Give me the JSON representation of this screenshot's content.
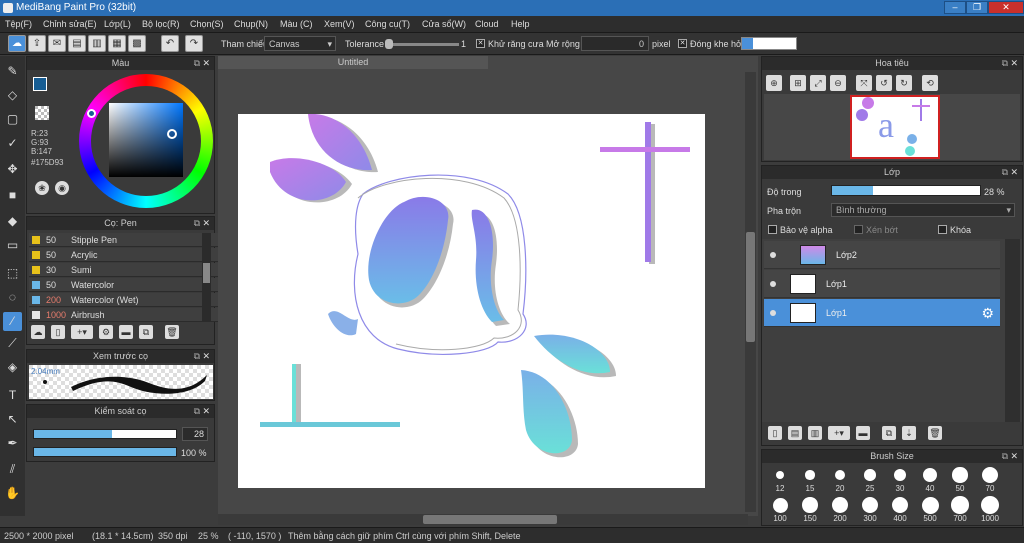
{
  "window": {
    "title": "MediBang Paint Pro (32bit)"
  },
  "menu": [
    "Tệp(F)",
    "Chỉnh sửa(E)",
    "Lớp(L)",
    "Bộ lọc(R)",
    "Chọn(S)",
    "Chụp(N)",
    "Màu (C)",
    "Xem(V)",
    "Công cụ(T)",
    "Cửa sổ(W)",
    "Cloud",
    "Help"
  ],
  "toolbar": {
    "reference_label": "Tham chiếu",
    "reference_value": "Canvas",
    "tolerance_label": "Tolerance",
    "tolerance_value": "1",
    "antialias_label": "Khử răng cưa",
    "expand_label": "Mở rộng",
    "expand_value": "0",
    "expand_unit": "pixel",
    "gap_close_label": "Đóng khe hở"
  },
  "color_panel": {
    "title": "Màu",
    "r": "R:23",
    "g": "G:93",
    "b": "B:147",
    "hex": "#175D93",
    "primary_color": "#175D93"
  },
  "brush_panel": {
    "title": "Cọ: Pen",
    "brushes": [
      {
        "size": "50",
        "name": "Stipple Pen",
        "color": "#e8c21a"
      },
      {
        "size": "50",
        "name": "Acrylic",
        "color": "#e8c21a"
      },
      {
        "size": "30",
        "name": "Sumi",
        "color": "#e8c21a"
      },
      {
        "size": "50",
        "name": "Watercolor",
        "color": "#6ab7e8"
      },
      {
        "size": "200",
        "name": "Watercolor (Wet)",
        "color": "#6ab7e8"
      },
      {
        "size": "1000",
        "name": "Airbrush",
        "color": "#e8e8e8"
      }
    ]
  },
  "brush_preview": {
    "title": "Xem trước cọ",
    "size": "2.04mm"
  },
  "brush_control": {
    "title": "Kiểm soát cọ",
    "size_value": "28",
    "opacity_value": "100 %",
    "size_fraction": 0.55,
    "opacity_fraction": 1.0
  },
  "canvas": {
    "tab": "Untitled"
  },
  "navigator": {
    "title": "Hoa tiêu"
  },
  "layer_panel": {
    "title": "Lớp",
    "opacity_label": "Độ trong",
    "opacity_value": "28 %",
    "opacity_fraction": 0.28,
    "blend_label": "Pha trộn",
    "blend_value": "Bình thường",
    "protect_alpha": "Bảo vệ alpha",
    "clipping": "Xén bớt",
    "lock": "Khóa",
    "layers": [
      {
        "name": "Lớp2",
        "selected": false
      },
      {
        "name": "Lớp1",
        "selected": false
      },
      {
        "name": "Lớp1",
        "selected": true
      }
    ]
  },
  "brush_size_panel": {
    "title": "Brush Size",
    "row1": [
      "12",
      "15",
      "20",
      "25",
      "30",
      "40",
      "50",
      "70"
    ],
    "row2": [
      "100",
      "150",
      "200",
      "300",
      "400",
      "500",
      "700",
      "1000"
    ]
  },
  "status": {
    "dimensions": "2500 * 2000 pixel",
    "physical": "(18.1 * 14.5cm)",
    "dpi": "350 dpi",
    "zoom": "25 %",
    "coords": "( -110, 1570 )",
    "hint": "Thêm bằng cách giữ phím Ctrl cùng với phím Shift, Delete"
  }
}
